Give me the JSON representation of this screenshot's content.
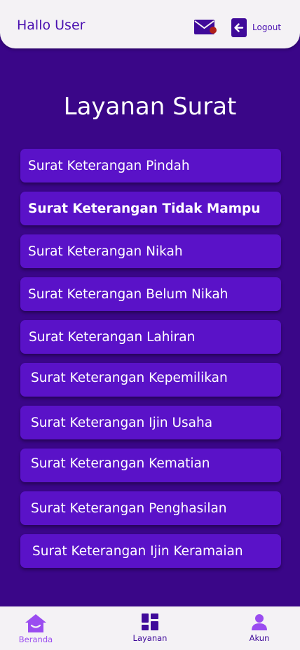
{
  "header": {
    "greeting": "Hallo User",
    "logout_label": "Logout"
  },
  "page_title": "Layanan Surat",
  "services": [
    "Surat Keterangan Pindah",
    "Surat Keterangan Tidak Mampu",
    "Surat Keterangan Nikah",
    "Surat Keterangan Belum Nikah",
    "Surat Keterangan Lahiran",
    "Surat Keterangan Kepemilikan",
    "Surat Keterangan Ijin Usaha",
    "Surat Keterangan Kematian",
    "Surat Keterangan Penghasilan",
    "Surat Keterangan Ijin Keramaian"
  ],
  "nav": {
    "home": {
      "label": "Beranda",
      "icon": "home-icon",
      "active": true
    },
    "services": {
      "label": "Layanan",
      "icon": "grid-icon"
    },
    "account": {
      "label": "Akun",
      "icon": "user-icon"
    }
  },
  "colors": {
    "background": "#3a0688",
    "card": "#5a12c8",
    "accent": "#4a10b0",
    "active_nav": "#9a4cf0",
    "notification_dot": "#b0201a"
  }
}
